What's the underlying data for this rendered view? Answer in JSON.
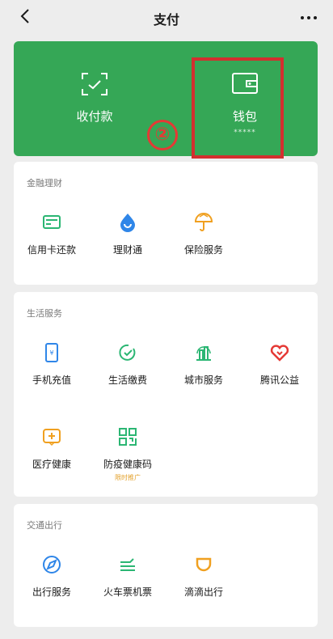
{
  "nav": {
    "title": "支付",
    "back_icon": "chevron-left-icon",
    "more_icon": "more-dots-icon"
  },
  "pay_card": {
    "color": "#35a756",
    "receive": {
      "label": "收付款",
      "icon": "scan-receive-icon"
    },
    "wallet": {
      "label": "钱包",
      "balance_masked": "*****",
      "icon": "wallet-icon"
    },
    "step_marker": "②",
    "highlight_color": "#d32f2f"
  },
  "finance": {
    "title": "金融理财",
    "items": [
      {
        "label": "信用卡还款",
        "icon": "credit-card-icon"
      },
      {
        "label": "理财通",
        "icon": "wealth-drop-icon"
      },
      {
        "label": "保险服务",
        "icon": "insurance-umbrella-icon"
      }
    ]
  },
  "life": {
    "title": "生活服务",
    "items": [
      {
        "label": "手机充值",
        "icon": "phone-topup-icon"
      },
      {
        "label": "生活缴费",
        "icon": "utility-bill-icon"
      },
      {
        "label": "城市服务",
        "icon": "city-service-icon"
      },
      {
        "label": "腾讯公益",
        "icon": "charity-heart-icon"
      },
      {
        "label": "医疗健康",
        "icon": "medical-health-icon"
      },
      {
        "label": "防疫健康码",
        "icon": "health-code-qr-icon",
        "tag": "限时推广"
      }
    ]
  },
  "transport": {
    "title": "交通出行",
    "items": [
      {
        "label": "出行服务",
        "icon": "travel-compass-icon"
      },
      {
        "label": "火车票机票",
        "icon": "train-ticket-icon"
      },
      {
        "label": "滴滴出行",
        "icon": "didi-icon"
      }
    ]
  }
}
